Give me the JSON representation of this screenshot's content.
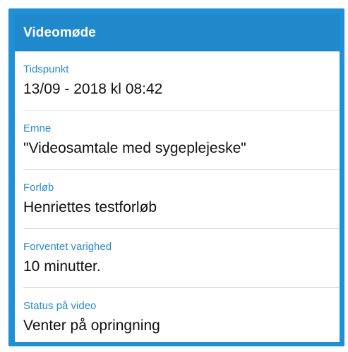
{
  "header": {
    "title": "Videomøde"
  },
  "fields": [
    {
      "label": "Tidspunkt",
      "value": "13/09 - 2018 kl 08:42"
    },
    {
      "label": "Emne",
      "value": "\"Videosamtale med sygeplejeske\""
    },
    {
      "label": "Forløb",
      "value": "Henriettes testforløb"
    },
    {
      "label": "Forventet varighed",
      "value": "10 minutter."
    },
    {
      "label": "Status på video",
      "value": "Venter på opringning"
    }
  ],
  "colors": {
    "header_bg": "#1f89cc",
    "border": "#1f8fd6",
    "label": "#2a8bd0",
    "value": "#111111",
    "divider": "#dcdcdc"
  }
}
